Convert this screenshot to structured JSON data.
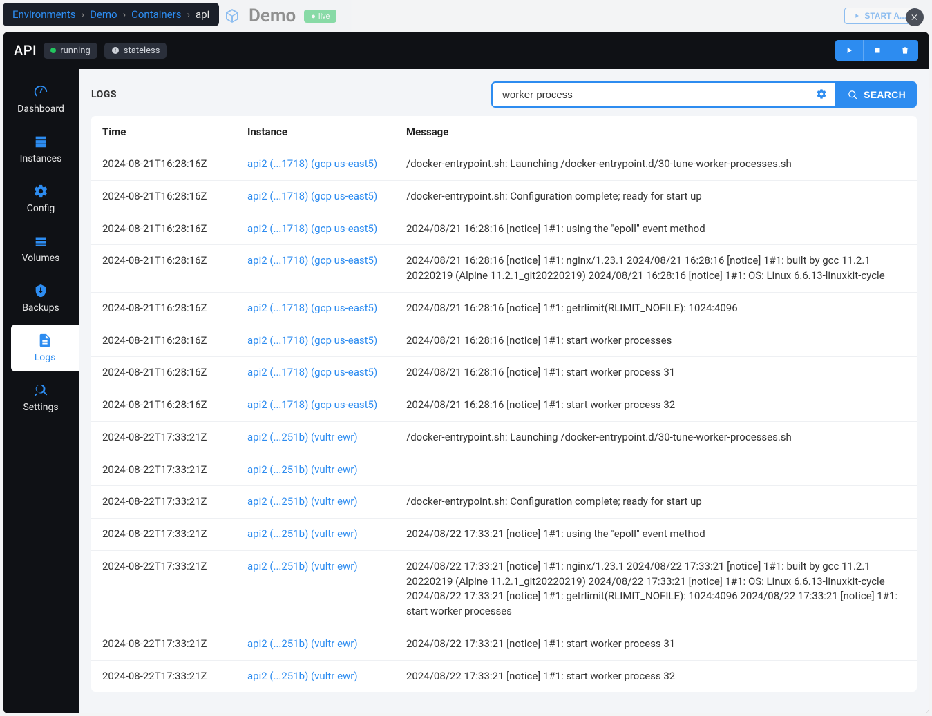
{
  "breadcrumb": {
    "items": [
      {
        "label": "Environments",
        "link": true
      },
      {
        "label": "Demo",
        "link": true
      },
      {
        "label": "Containers",
        "link": true
      },
      {
        "label": "api",
        "link": false
      }
    ]
  },
  "background": {
    "title": "Demo",
    "badge": "live",
    "start_button": "START A..."
  },
  "modal": {
    "title": "API",
    "status_pill": "running",
    "type_pill": "stateless"
  },
  "sidebar": {
    "items": [
      {
        "key": "dashboard",
        "label": "Dashboard"
      },
      {
        "key": "instances",
        "label": "Instances"
      },
      {
        "key": "config",
        "label": "Config"
      },
      {
        "key": "volumes",
        "label": "Volumes"
      },
      {
        "key": "backups",
        "label": "Backups"
      },
      {
        "key": "logs",
        "label": "Logs",
        "active": true
      },
      {
        "key": "settings",
        "label": "Settings"
      }
    ]
  },
  "logs": {
    "title": "LOGS",
    "search_value": "worker process",
    "search_button": "SEARCH",
    "columns": [
      "Time",
      "Instance",
      "Message"
    ],
    "rows": [
      {
        "time": "2024-08-21T16:28:16Z",
        "instance": "api2 (...1718) (gcp us-east5)",
        "message": "/docker-entrypoint.sh: Launching /docker-entrypoint.d/30-tune-worker-processes.sh"
      },
      {
        "time": "2024-08-21T16:28:16Z",
        "instance": "api2 (...1718) (gcp us-east5)",
        "message": "/docker-entrypoint.sh: Configuration complete; ready for start up"
      },
      {
        "time": "2024-08-21T16:28:16Z",
        "instance": "api2 (...1718) (gcp us-east5)",
        "message": "2024/08/21 16:28:16 [notice] 1#1: using the \"epoll\" event method"
      },
      {
        "time": "2024-08-21T16:28:16Z",
        "instance": "api2 (...1718) (gcp us-east5)",
        "message": "2024/08/21 16:28:16 [notice] 1#1: nginx/1.23.1 2024/08/21 16:28:16 [notice] 1#1: built by gcc 11.2.1 20220219 (Alpine 11.2.1_git20220219) 2024/08/21 16:28:16 [notice] 1#1: OS: Linux 6.6.13-linuxkit-cycle"
      },
      {
        "time": "2024-08-21T16:28:16Z",
        "instance": "api2 (...1718) (gcp us-east5)",
        "message": "2024/08/21 16:28:16 [notice] 1#1: getrlimit(RLIMIT_NOFILE): 1024:4096"
      },
      {
        "time": "2024-08-21T16:28:16Z",
        "instance": "api2 (...1718) (gcp us-east5)",
        "message": "2024/08/21 16:28:16 [notice] 1#1: start worker processes"
      },
      {
        "time": "2024-08-21T16:28:16Z",
        "instance": "api2 (...1718) (gcp us-east5)",
        "message": "2024/08/21 16:28:16 [notice] 1#1: start worker process 31"
      },
      {
        "time": "2024-08-21T16:28:16Z",
        "instance": "api2 (...1718) (gcp us-east5)",
        "message": "2024/08/21 16:28:16 [notice] 1#1: start worker process 32"
      },
      {
        "time": "2024-08-22T17:33:21Z",
        "instance": "api2 (...251b) (vultr ewr)",
        "message": "/docker-entrypoint.sh: Launching /docker-entrypoint.d/30-tune-worker-processes.sh"
      },
      {
        "time": "2024-08-22T17:33:21Z",
        "instance": "api2 (...251b) (vultr ewr)",
        "message": ""
      },
      {
        "time": "2024-08-22T17:33:21Z",
        "instance": "api2 (...251b) (vultr ewr)",
        "message": "/docker-entrypoint.sh: Configuration complete; ready for start up"
      },
      {
        "time": "2024-08-22T17:33:21Z",
        "instance": "api2 (...251b) (vultr ewr)",
        "message": "2024/08/22 17:33:21 [notice] 1#1: using the \"epoll\" event method"
      },
      {
        "time": "2024-08-22T17:33:21Z",
        "instance": "api2 (...251b) (vultr ewr)",
        "message": "2024/08/22 17:33:21 [notice] 1#1: nginx/1.23.1 2024/08/22 17:33:21 [notice] 1#1: built by gcc 11.2.1 20220219 (Alpine 11.2.1_git20220219) 2024/08/22 17:33:21 [notice] 1#1: OS: Linux 6.6.13-linuxkit-cycle 2024/08/22 17:33:21 [notice] 1#1: getrlimit(RLIMIT_NOFILE): 1024:4096 2024/08/22 17:33:21 [notice] 1#1: start worker processes"
      },
      {
        "time": "2024-08-22T17:33:21Z",
        "instance": "api2 (...251b) (vultr ewr)",
        "message": "2024/08/22 17:33:21 [notice] 1#1: start worker process 31"
      },
      {
        "time": "2024-08-22T17:33:21Z",
        "instance": "api2 (...251b) (vultr ewr)",
        "message": "2024/08/22 17:33:21 [notice] 1#1: start worker process 32"
      }
    ]
  }
}
